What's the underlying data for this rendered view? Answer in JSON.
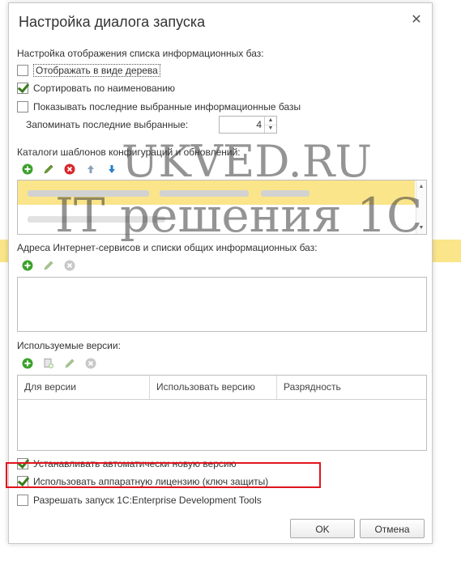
{
  "dialog": {
    "title": "Настройка диалога запуска"
  },
  "display_section": {
    "heading": "Настройка отображения списка информационных баз:",
    "show_tree": {
      "label": "Отображать в виде дерева",
      "checked": false
    },
    "sort_by_name": {
      "label": "Сортировать по наименованию",
      "checked": true
    },
    "show_recent": {
      "label": "Показывать последние выбранные информационные базы",
      "checked": false
    },
    "remember_recent": {
      "label": "Запоминать последние выбранные:",
      "value": "4"
    }
  },
  "templates_section": {
    "heading": "Каталоги шаблонов конфигураций и обновлений:"
  },
  "services_section": {
    "heading": "Адреса Интернет-сервисов и списки общих информационных баз:"
  },
  "versions_section": {
    "heading": "Используемые версии:",
    "columns": [
      "Для версии",
      "Использовать версию",
      "Разрядность"
    ]
  },
  "options": {
    "auto_install": {
      "label": "Устанавливать автоматически новую версию",
      "checked": true
    },
    "hardware_license": {
      "label": "Использовать аппаратную лицензию (ключ защиты)",
      "checked": true
    },
    "edt": {
      "label": "Разрешать запуск 1C:Enterprise Development Tools",
      "checked": false
    }
  },
  "buttons": {
    "ok": "OK",
    "cancel": "Отмена"
  },
  "watermark": {
    "line1": "UKVED.RU",
    "line2": "IT решения 1С"
  },
  "colors": {
    "highlight": "#e0141c",
    "check": "#3a7b1e",
    "band": "#fbe58a"
  }
}
